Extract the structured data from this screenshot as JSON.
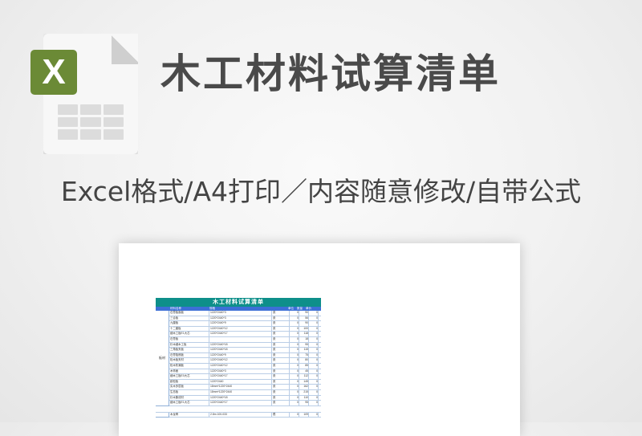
{
  "header": {
    "file_icon": {
      "name": "excel-file-icon",
      "badge_letter": "X",
      "badge_color": "#6b8a36"
    },
    "title": "木工材料试算清单"
  },
  "subtitle": "Excel格式/A4打印／内容随意修改/自带公式",
  "preview": {
    "sheet_title": "木工材料试算清单",
    "accent_color": "#0e8f8a",
    "header_color": "#3d6fd6",
    "columns": [
      "材料名称",
      "规格",
      "",
      "单位",
      "数量",
      "单价",
      "金额"
    ],
    "category": "板材",
    "rows": [
      [
        "石膏板面板",
        "1220*2440*3",
        "张",
        "0",
        "90",
        "0"
      ],
      [
        "三合板",
        "1220*2440*3",
        "张",
        "0",
        "56",
        "0"
      ],
      [
        "九厘板",
        "1220*2440*9",
        "张",
        "0",
        "90",
        "0"
      ],
      [
        "十二厘板",
        "1220*2440*12",
        "张",
        "0",
        "100",
        "0"
      ],
      [
        "细木工板E1大芯",
        "1220*2440*17",
        "张",
        "0",
        "118",
        "0"
      ],
      [
        "石膏板",
        "",
        "张",
        "0",
        "18",
        "0"
      ],
      [
        "杉木细木工板",
        "1220*2440*18",
        "张",
        "0",
        "95",
        "0"
      ],
      [
        "三角板夹板",
        "1220*2440*18",
        "张",
        "0",
        "115",
        "0"
      ],
      [
        "石膏阻燃板",
        "1220*2440*9",
        "张",
        "0",
        "75",
        "0"
      ],
      [
        "松木板夹材",
        "1220*2440*12",
        "张",
        "0",
        "80",
        "0"
      ],
      [
        "松木防潮板",
        "1220*2440*12",
        "张",
        "0",
        "85",
        "0"
      ],
      [
        "木饰面",
        "1220*2440*3",
        "张",
        "0",
        "45",
        "0"
      ],
      [
        "细木工板E0大芯",
        "1220*2440*17",
        "张",
        "0",
        "112",
        "0"
      ],
      [
        "欧松板",
        "1220*2440",
        "张",
        "0",
        "145",
        "0"
      ],
      [
        "实木多层板",
        "18mm*1220*2440",
        "张",
        "0",
        "162",
        "0"
      ],
      [
        "生态板",
        "18mm*1220*2440",
        "张",
        "0",
        "215",
        "0"
      ],
      [
        "杉木集成材",
        "1220*2440*18",
        "张",
        "0",
        "110",
        "0"
      ],
      [
        "细木工板E1大芯",
        "1220*2440*17",
        "张",
        "0",
        "95",
        "0"
      ]
    ],
    "footer_row": [
      "木龙骨",
      "2.8m 100-033",
      "根",
      "0",
      "109",
      "0"
    ]
  }
}
